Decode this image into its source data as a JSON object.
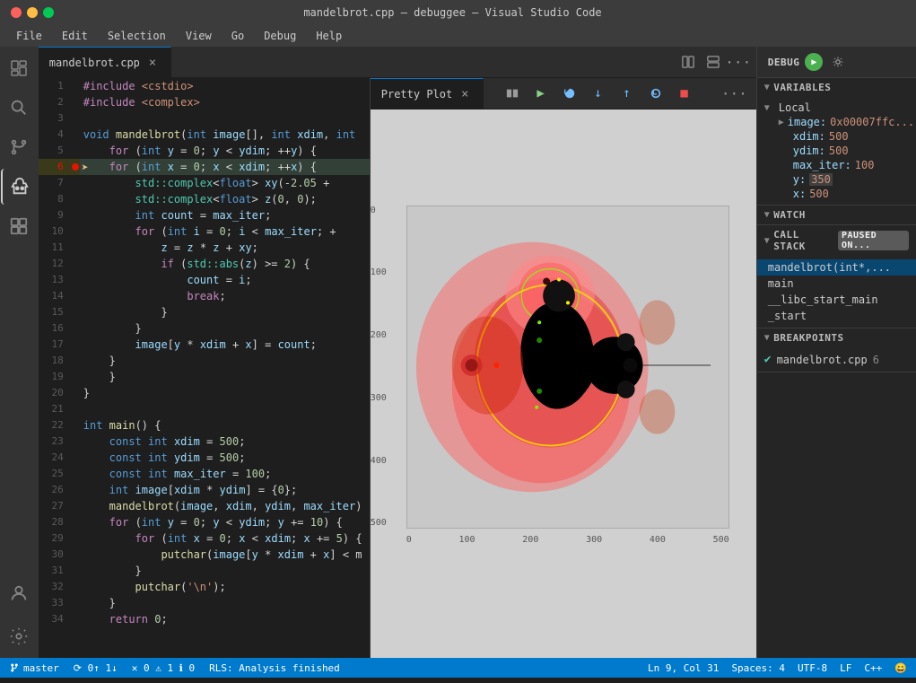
{
  "titlebar": {
    "title": "mandelbrot.cpp — debuggee — Visual Studio Code"
  },
  "menubar": {
    "items": [
      "File",
      "Edit",
      "Selection",
      "View",
      "Go",
      "Debug",
      "Help"
    ]
  },
  "tabs": {
    "editor_tab": "mandelbrot.cpp",
    "plot_tab": "Pretty Plot"
  },
  "debug_toolbar": {
    "buttons": [
      "⠿",
      "▶",
      "↺",
      "⬇",
      "⬆",
      "↩",
      "⏹"
    ]
  },
  "debug_label": "DEBUG",
  "code_lines": [
    {
      "num": 1,
      "content": "#include <cstdio>"
    },
    {
      "num": 2,
      "content": "#include <complex>"
    },
    {
      "num": 3,
      "content": ""
    },
    {
      "num": 4,
      "content": "void mandelbrot(int image[], int xdim, int"
    },
    {
      "num": 5,
      "content": "    for (int y = 0; y < ydim; ++y) {"
    },
    {
      "num": 6,
      "content": "        for (int x = 0; x < xdim; ++x) {",
      "breakpoint": true,
      "current": true
    },
    {
      "num": 7,
      "content": "            std::complex<float> xy(-2.05 +"
    },
    {
      "num": 8,
      "content": "            std::complex<float> z(0, 0);"
    },
    {
      "num": 9,
      "content": "            int count = max_iter;"
    },
    {
      "num": 10,
      "content": "            for (int i = 0; i < max_iter; +"
    },
    {
      "num": 11,
      "content": "                z = z * z + xy;"
    },
    {
      "num": 12,
      "content": "                if (std::abs(z) >= 2) {"
    },
    {
      "num": 13,
      "content": "                    count = i;"
    },
    {
      "num": 14,
      "content": "                    break;"
    },
    {
      "num": 15,
      "content": "                }"
    },
    {
      "num": 16,
      "content": "            }"
    },
    {
      "num": 17,
      "content": "            image[y * xdim + x] = count;"
    },
    {
      "num": 18,
      "content": "        }"
    },
    {
      "num": 19,
      "content": "    }"
    },
    {
      "num": 20,
      "content": "}"
    },
    {
      "num": 21,
      "content": ""
    },
    {
      "num": 22,
      "content": "int main() {"
    },
    {
      "num": 23,
      "content": "    const int xdim = 500;"
    },
    {
      "num": 24,
      "content": "    const int ydim = 500;"
    },
    {
      "num": 25,
      "content": "    const int max_iter = 100;"
    },
    {
      "num": 26,
      "content": "    int image[xdim * ydim] = {0};"
    },
    {
      "num": 27,
      "content": "    mandelbrot(image, xdim, ydim, max_iter)"
    },
    {
      "num": 28,
      "content": "    for (int y = 0; y < ydim; y += 10) {"
    },
    {
      "num": 29,
      "content": "        for (int x = 0; x < xdim; x += 5) {"
    },
    {
      "num": 30,
      "content": "            putchar(image[y * xdim + x] < m"
    },
    {
      "num": 31,
      "content": "        }"
    },
    {
      "num": 32,
      "content": "        putchar('\\n');"
    },
    {
      "num": 33,
      "content": "    }"
    },
    {
      "num": 34,
      "content": "    return 0;"
    }
  ],
  "variables": {
    "section_title": "VARIABLES",
    "local_label": "Local",
    "items": [
      {
        "name": "image:",
        "value": "0x00007ffc..."
      },
      {
        "name": "xdim:",
        "value": "500"
      },
      {
        "name": "ydim:",
        "value": "500"
      },
      {
        "name": "max_iter:",
        "value": "100"
      },
      {
        "name": "y:",
        "value": "350"
      },
      {
        "name": "x:",
        "value": "500"
      }
    ]
  },
  "watch": {
    "section_title": "WATCH"
  },
  "call_stack": {
    "section_title": "CALL STACK",
    "paused_label": "PAUSED ON...",
    "items": [
      {
        "name": "mandelbrot(int*,...",
        "active": true
      },
      {
        "name": "main"
      },
      {
        "name": "__libc_start_main"
      },
      {
        "name": "_start"
      }
    ]
  },
  "breakpoints": {
    "section_title": "BREAKPOINTS",
    "items": [
      {
        "file": "mandelbrot.cpp",
        "line": "6",
        "checked": true
      }
    ]
  },
  "statusbar": {
    "branch": "master",
    "sync": "⟳ 0↑ 1↓",
    "errors": "✕ 0  ⚠ 1  ℹ 0",
    "rls": "RLS: Analysis finished",
    "position": "Ln 9, Col 31",
    "spaces": "Spaces: 4",
    "encoding": "UTF-8",
    "line_ending": "LF",
    "language": "C++",
    "emoji": "😀"
  },
  "plot": {
    "x_min": 0,
    "x_max": 500,
    "y_min": 0,
    "y_max": 500,
    "x_ticks": [
      0,
      100,
      200,
      300,
      400,
      500
    ],
    "y_ticks": [
      100,
      200,
      300,
      400,
      500
    ]
  },
  "icons": {
    "file_explorer": "☰",
    "search": "🔍",
    "source_control": "⑂",
    "debug": "🐛",
    "extensions": "⊞",
    "split_editor": "⧉",
    "more_actions": "···"
  }
}
